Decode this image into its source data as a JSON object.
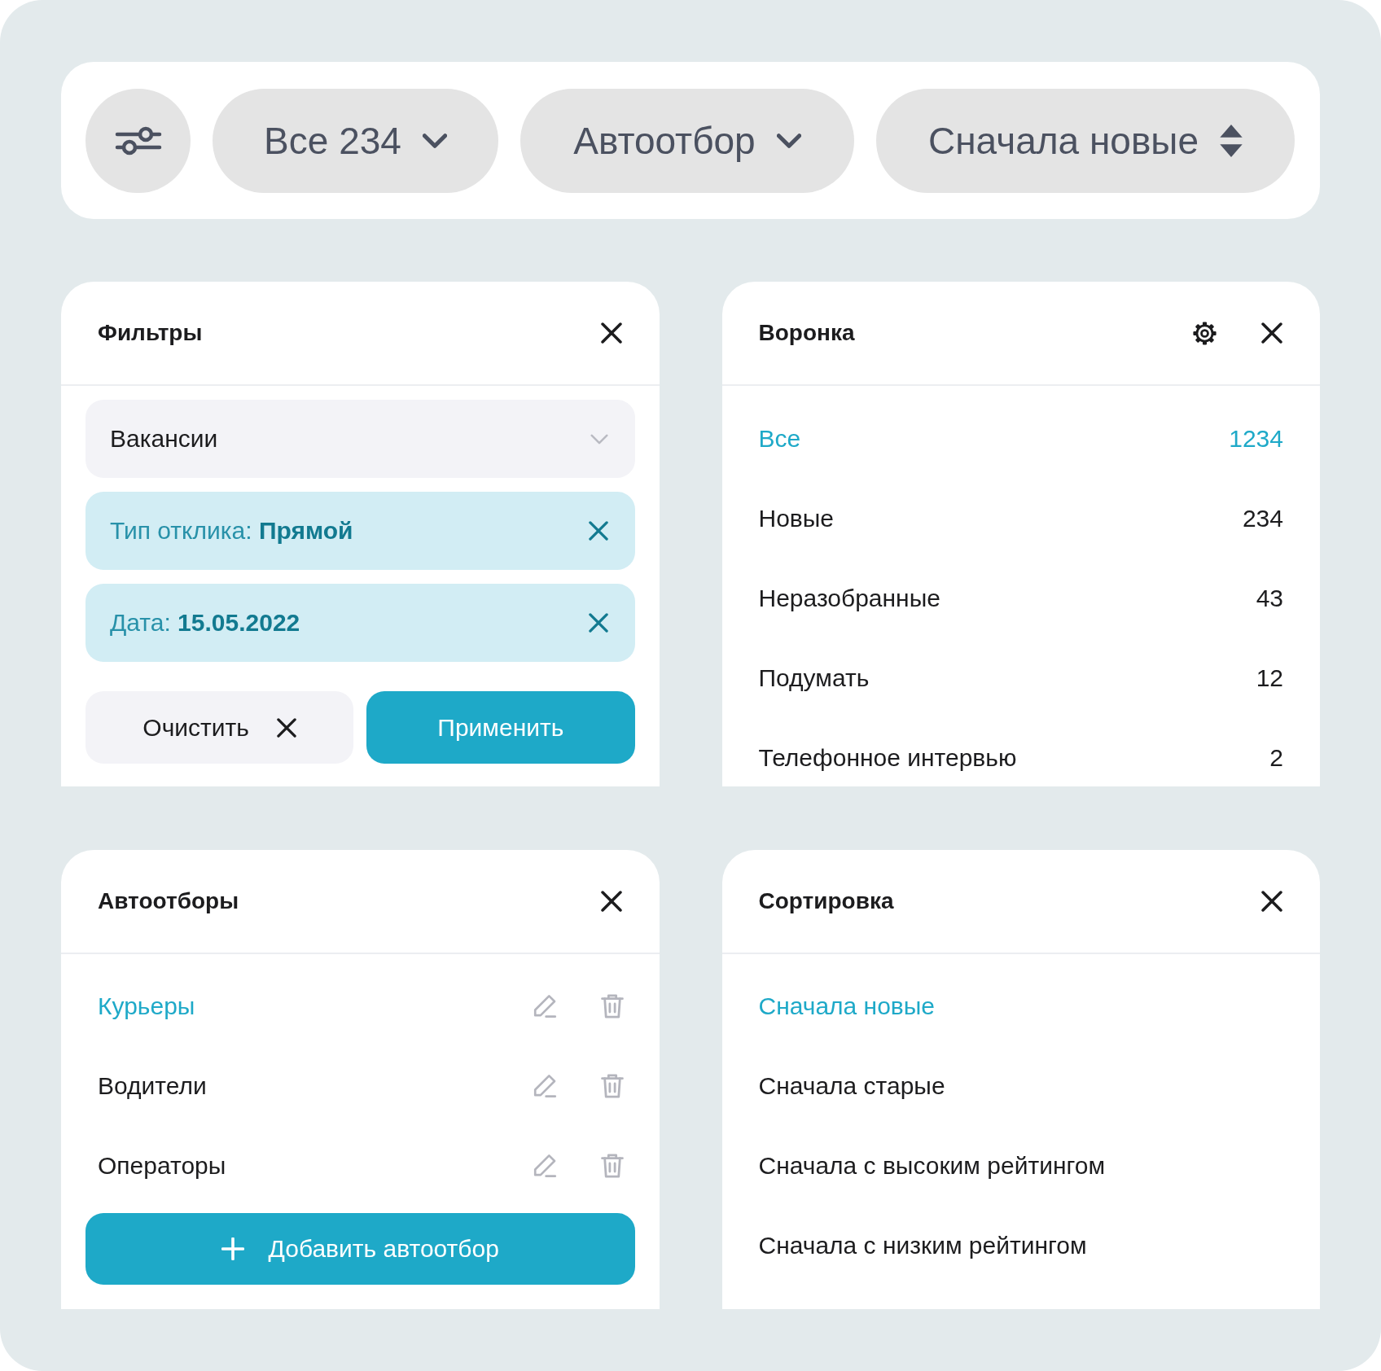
{
  "toolbar": {
    "dropdowns": [
      {
        "label": "Все 234",
        "kind": "dropdown"
      },
      {
        "label": "Автоотбор",
        "kind": "dropdown"
      },
      {
        "label": "Сначала новые",
        "kind": "sort"
      }
    ]
  },
  "filters_panel": {
    "title": "Фильтры",
    "select": {
      "value": "Вакансии"
    },
    "chips": [
      {
        "text": "Тип отклика: **Прямой**"
      },
      {
        "text": "Дата: **15.05.2022**"
      }
    ],
    "clear_button": "Очистить",
    "apply_button": "Применить"
  },
  "funnel_panel": {
    "title": "Воронка",
    "stages": [
      {
        "name": "Все",
        "count": "1234",
        "selected": true
      },
      {
        "name": "Новые",
        "count": "234",
        "selected": false
      },
      {
        "name": "Неразобранные",
        "count": "43",
        "selected": false
      },
      {
        "name": "Подумать",
        "count": "12",
        "selected": false
      },
      {
        "name": "Телефонное интервью",
        "count": "2",
        "selected": false
      }
    ]
  },
  "autoselect_panel": {
    "title": "Автоотборы",
    "items": [
      {
        "name": "Курьеры",
        "selected": true
      },
      {
        "name": "Водители",
        "selected": false
      },
      {
        "name": "Операторы",
        "selected": false
      }
    ],
    "add_button": "Добавить автоотбор"
  },
  "sort_panel": {
    "title": "Сортировка",
    "options": [
      {
        "label": "Сначала новые",
        "selected": true
      },
      {
        "label": "Сначала старые",
        "selected": false
      },
      {
        "label": "Сначала с высоким рейтингом",
        "selected": false
      },
      {
        "label": "Сначала с низким рейтингом",
        "selected": false
      }
    ]
  }
}
